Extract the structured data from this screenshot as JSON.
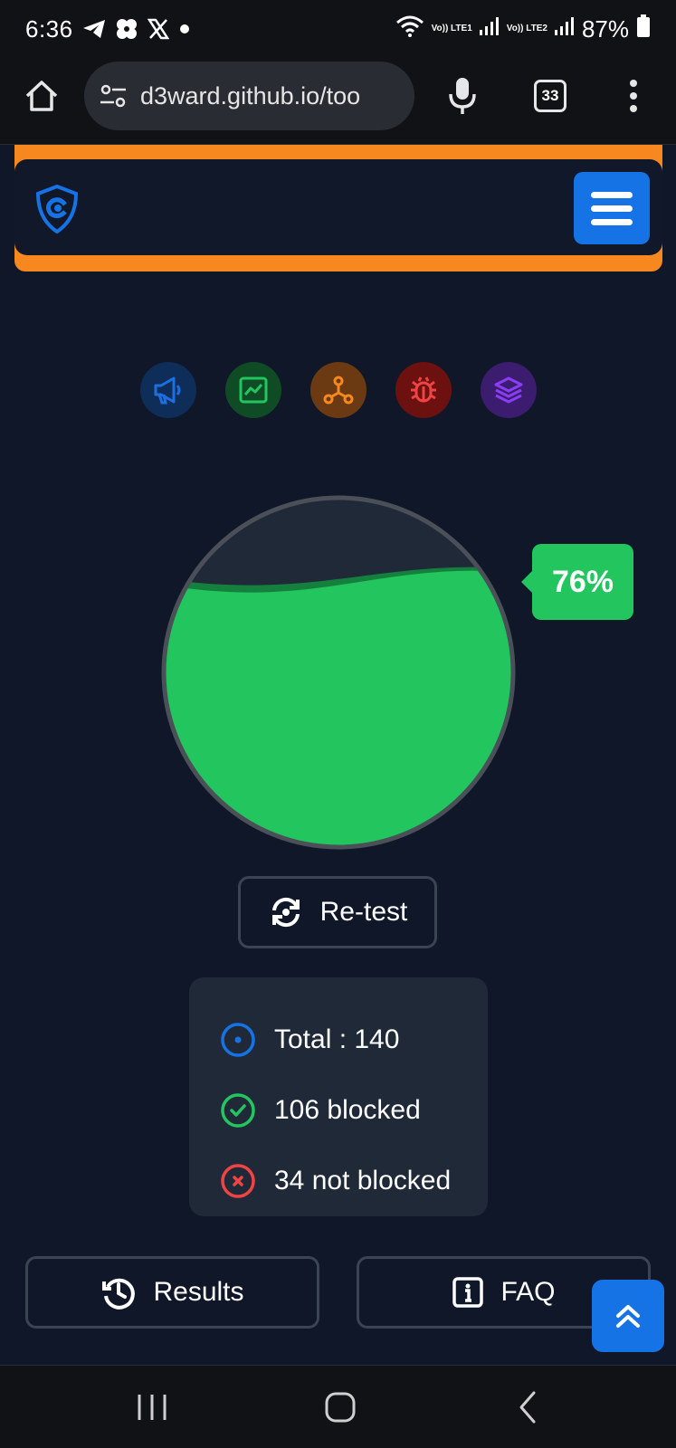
{
  "status_bar": {
    "time": "6:36",
    "net1_label": "Vo)) LTE1",
    "net2_label": "Vo)) LTE2",
    "battery": "87%",
    "notification_icons": [
      "telegram-icon",
      "pinwheel-icon",
      "x-icon",
      "dot-icon"
    ]
  },
  "browser": {
    "url": "d3ward.github.io/too",
    "tab_count": "33"
  },
  "categories": [
    {
      "name": "ads",
      "icon": "megaphone-icon",
      "color": "#1d6fe0",
      "bg": "#0e2d59"
    },
    {
      "name": "analytics",
      "icon": "chart-icon",
      "color": "#22c55e",
      "bg": "#0f4c26"
    },
    {
      "name": "trackers",
      "icon": "network-icon",
      "color": "#f7881f",
      "bg": "#6b3a12"
    },
    {
      "name": "malware",
      "icon": "bug-icon",
      "color": "#ef4444",
      "bg": "#6d1010"
    },
    {
      "name": "other",
      "icon": "layers-icon",
      "color": "#8b3cf6",
      "bg": "#3b1c6e"
    }
  ],
  "score": {
    "percent": 76,
    "label": "76%",
    "fill_color": "#22c55e"
  },
  "retest_label": "Re-test",
  "stats": {
    "total": "Total : 140",
    "blocked": "106 blocked",
    "not_blocked": "34 not blocked"
  },
  "buttons": {
    "results": "Results",
    "faq": "FAQ"
  },
  "colors": {
    "accent": "#1673e6",
    "header_border": "#f7881f",
    "success": "#22c55e",
    "danger": "#ef4444"
  }
}
